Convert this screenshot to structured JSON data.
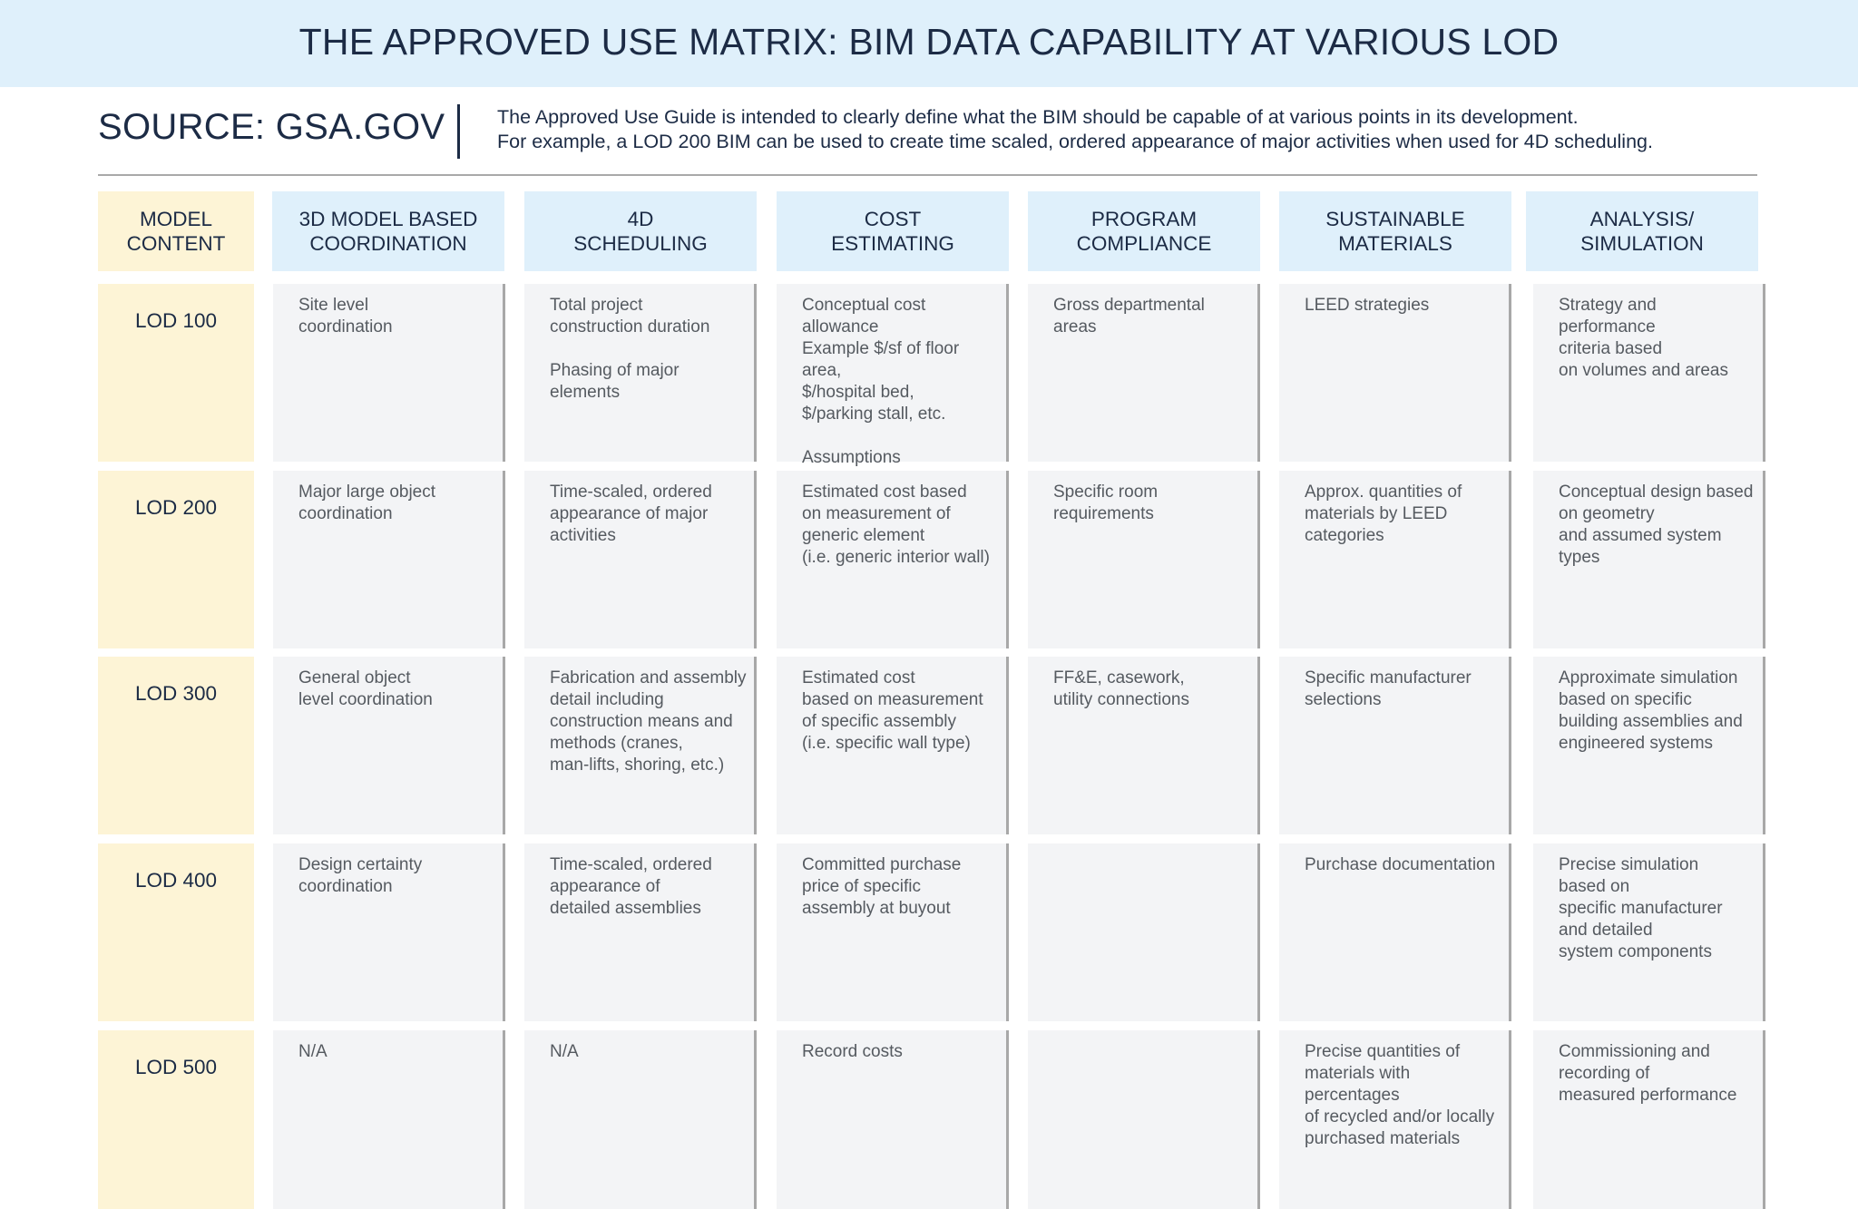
{
  "banner": {
    "title": "THE APPROVED USE MATRIX: BIM DATA CAPABILITY AT VARIOUS LOD"
  },
  "source": {
    "label": "SOURCE: GSA.GOV",
    "description_line1": "The Approved Use Guide is intended to clearly define what the BIM should be capable of at various points in its development.",
    "description_line2": "For example, a LOD 200 BIM can be used to create time scaled, ordered appearance of major activities when used for 4D scheduling."
  },
  "colors": {
    "navy_text": "#1c2b45",
    "header_blue": "#dff0fb",
    "header_yellow": "#fdf4d6",
    "cell_gray": "#f3f4f6",
    "body_text": "#555a60"
  },
  "matrix": {
    "columns": [
      "MODEL\nCONTENT",
      "3D MODEL BASED\nCOORDINATION",
      "4D\nSCHEDULING",
      "COST\nESTIMATING",
      "PROGRAM\nCOMPLIANCE",
      "SUSTAINABLE\nMATERIALS",
      "ANALYSIS/\nSIMULATION"
    ],
    "rows": [
      {
        "lod": "LOD 100",
        "cells": [
          "Site level\ncoordination",
          "Total project\nconstruction duration\n\nPhasing of major elements",
          "Conceptual cost allowance\nExample $/sf of floor area,\n$/hospital bed,\n$/parking stall, etc.\n\nAssumptions\non future content",
          "Gross departmental\nareas",
          "LEED strategies",
          "Strategy and performance\ncriteria based\non volumes and areas"
        ]
      },
      {
        "lod": "LOD 200",
        "cells": [
          "Major large object\ncoordination",
          "Time-scaled, ordered\nappearance of major\nactivities",
          "Estimated cost based\non measurement of\ngeneric element\n(i.e. generic interior wall)",
          "Specific room\nrequirements",
          "Approx. quantities of\nmaterials by LEED\ncategories",
          "Conceptual design based\non geometry\nand assumed system types"
        ]
      },
      {
        "lod": "LOD 300",
        "cells": [
          "General object\nlevel coordination",
          "Fabrication and assembly\ndetail including\nconstruction means and\nmethods (cranes,\nman-lifts, shoring, etc.)",
          "Estimated cost\n based on measurement\nof specific assembly\n(i.e. specific wall type)",
          "FF&E, casework,\nutility connections",
          "Specific manufacturer\n selections",
          "Approximate simulation\nbased on specific\nbuilding assemblies and\nengineered systems"
        ]
      },
      {
        "lod": "LOD 400",
        "cells": [
          "Design certainty\n coordination",
          "Time-scaled, ordered\nappearance of\ndetailed assemblies",
          "Committed purchase\nprice of specific\nassembly at buyout",
          "",
          "Purchase documentation",
          "Precise simulation\nbased on\nspecific manufacturer\nand  detailed\nsystem components"
        ]
      },
      {
        "lod": "LOD 500",
        "cells": [
          "N/A",
          "N/A",
          "Record costs",
          "",
          "Precise quantities of\nmaterials with percentages\n of recycled and/or locally\npurchased materials",
          "Commissioning and\nrecording of\nmeasured performance"
        ]
      }
    ]
  }
}
